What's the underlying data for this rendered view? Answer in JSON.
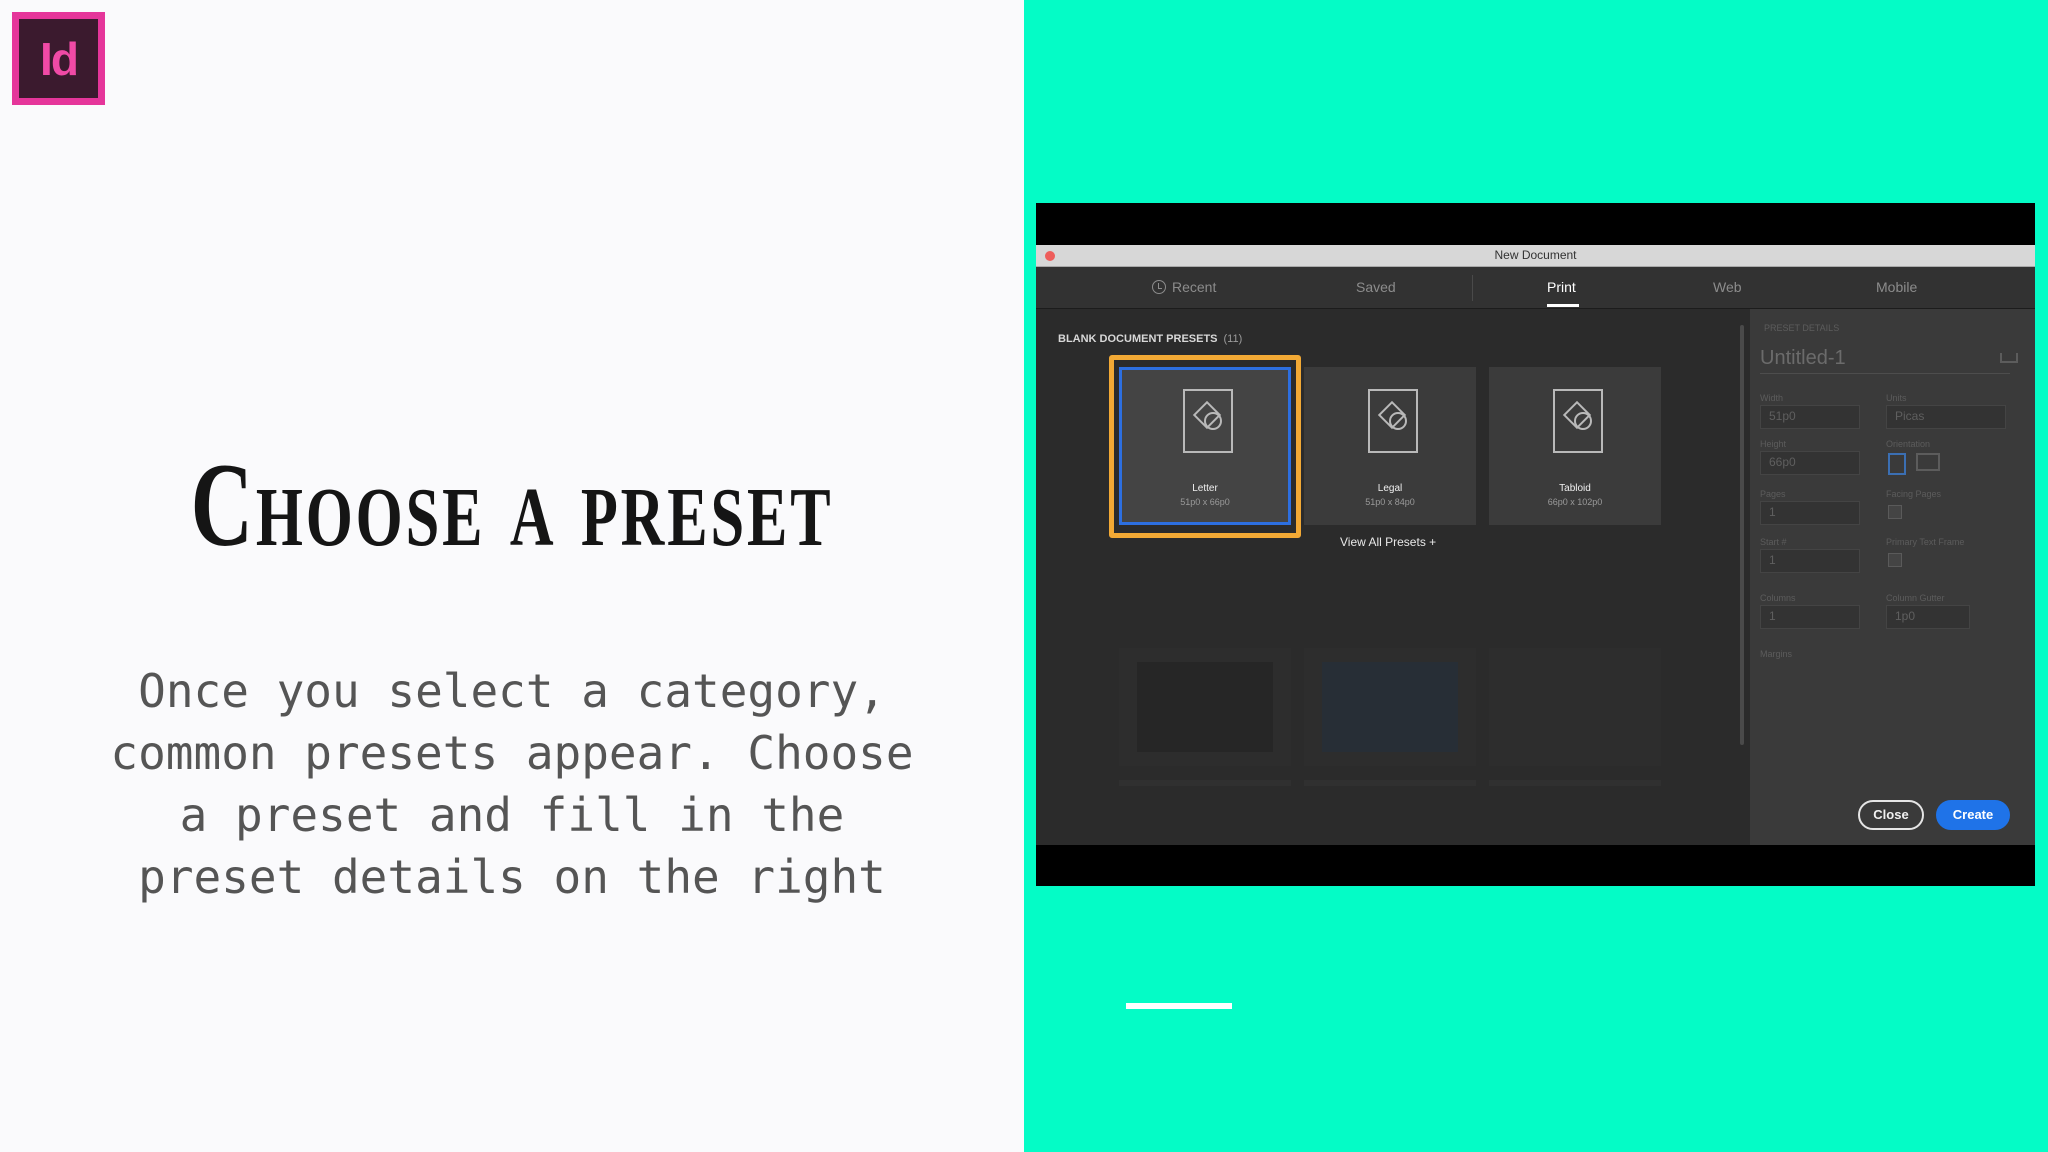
{
  "slide": {
    "title": "Choose a preset",
    "body": "Once you select a category, common presets appear. Choose a preset and fill in the preset details on the right",
    "logo_text": "Id"
  },
  "dialog": {
    "window_title": "New Document",
    "tabs": [
      {
        "label": "Recent",
        "icon": "clock-icon"
      },
      {
        "label": "Saved"
      },
      {
        "label": "Print",
        "active": true
      },
      {
        "label": "Web"
      },
      {
        "label": "Mobile"
      }
    ],
    "presets_heading": "BLANK DOCUMENT PRESETS",
    "presets_count": "(11)",
    "presets": [
      {
        "name": "Letter",
        "size": "51p0 x 66p0",
        "selected": true
      },
      {
        "name": "Legal",
        "size": "51p0 x 84p0"
      },
      {
        "name": "Tabloid",
        "size": "66p0 x 102p0"
      }
    ],
    "view_all": "View All Presets",
    "details": {
      "caption": "PRESET DETAILS",
      "document_name": "Untitled-1",
      "width_label": "Width",
      "width_value": "51p0",
      "units_label": "Units",
      "units_value": "Picas",
      "height_label": "Height",
      "height_value": "66p0",
      "orientation_label": "Orientation",
      "pages_label": "Pages",
      "pages_value": "1",
      "facing_label": "Facing Pages",
      "start_label": "Start #",
      "start_value": "1",
      "primary_label": "Primary Text Frame",
      "columns_label": "Columns",
      "columns_value": "1",
      "gutter_label": "Column Gutter",
      "gutter_value": "1p0",
      "margins_label": "Margins",
      "close_label": "Close",
      "create_label": "Create"
    }
  },
  "colors": {
    "accent_panel": "#04fcc6",
    "logo_pink": "#e5359a",
    "selection_orange": "#f2a935",
    "create_blue": "#1f73e8"
  }
}
